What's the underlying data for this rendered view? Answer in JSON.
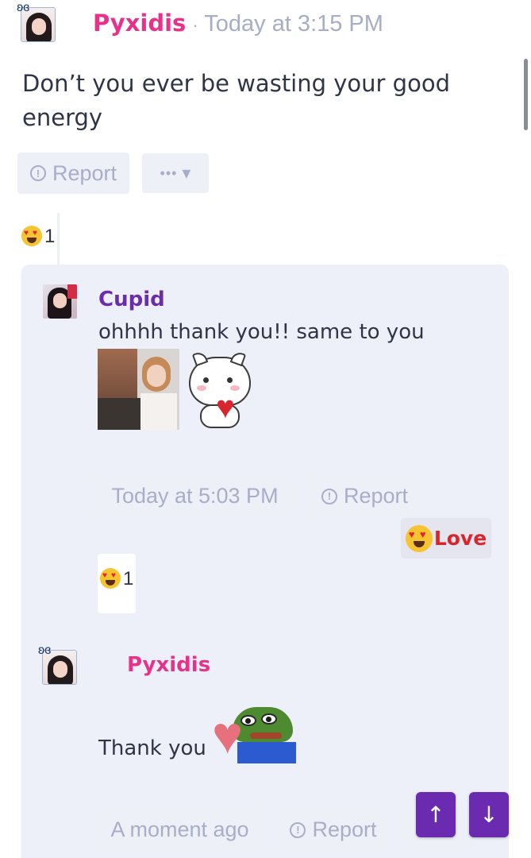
{
  "messages": [
    {
      "username": "Pyxidis",
      "separator": "·",
      "timestamp": "Today at 3:15 PM",
      "text_line1": "Don’t you ever be wasting your good",
      "text_line2": "energy",
      "report_label": "Report",
      "more_label": "•••",
      "reaction_count": "1"
    },
    {
      "username": "Cupid",
      "text": "ohhhh thank you!! same to you",
      "timestamp": "Today at 5:03 PM",
      "report_label": "Report",
      "love_label": "Love",
      "reaction_count": "1"
    },
    {
      "username": "Pyxidis",
      "text": "Thank you",
      "timestamp": "A moment ago",
      "report_label": "Report"
    }
  ],
  "nav": {
    "up_glyph": "↑",
    "down_glyph": "↓"
  },
  "icons": {
    "info": "!",
    "dropdown": "▾",
    "butterfly": "🦋"
  },
  "colors": {
    "username_pyxidis": "#e8318a",
    "username_cupid": "#6b2ea8",
    "nav_button": "#6a2bb0",
    "thread_bg": "#eef0f9"
  }
}
